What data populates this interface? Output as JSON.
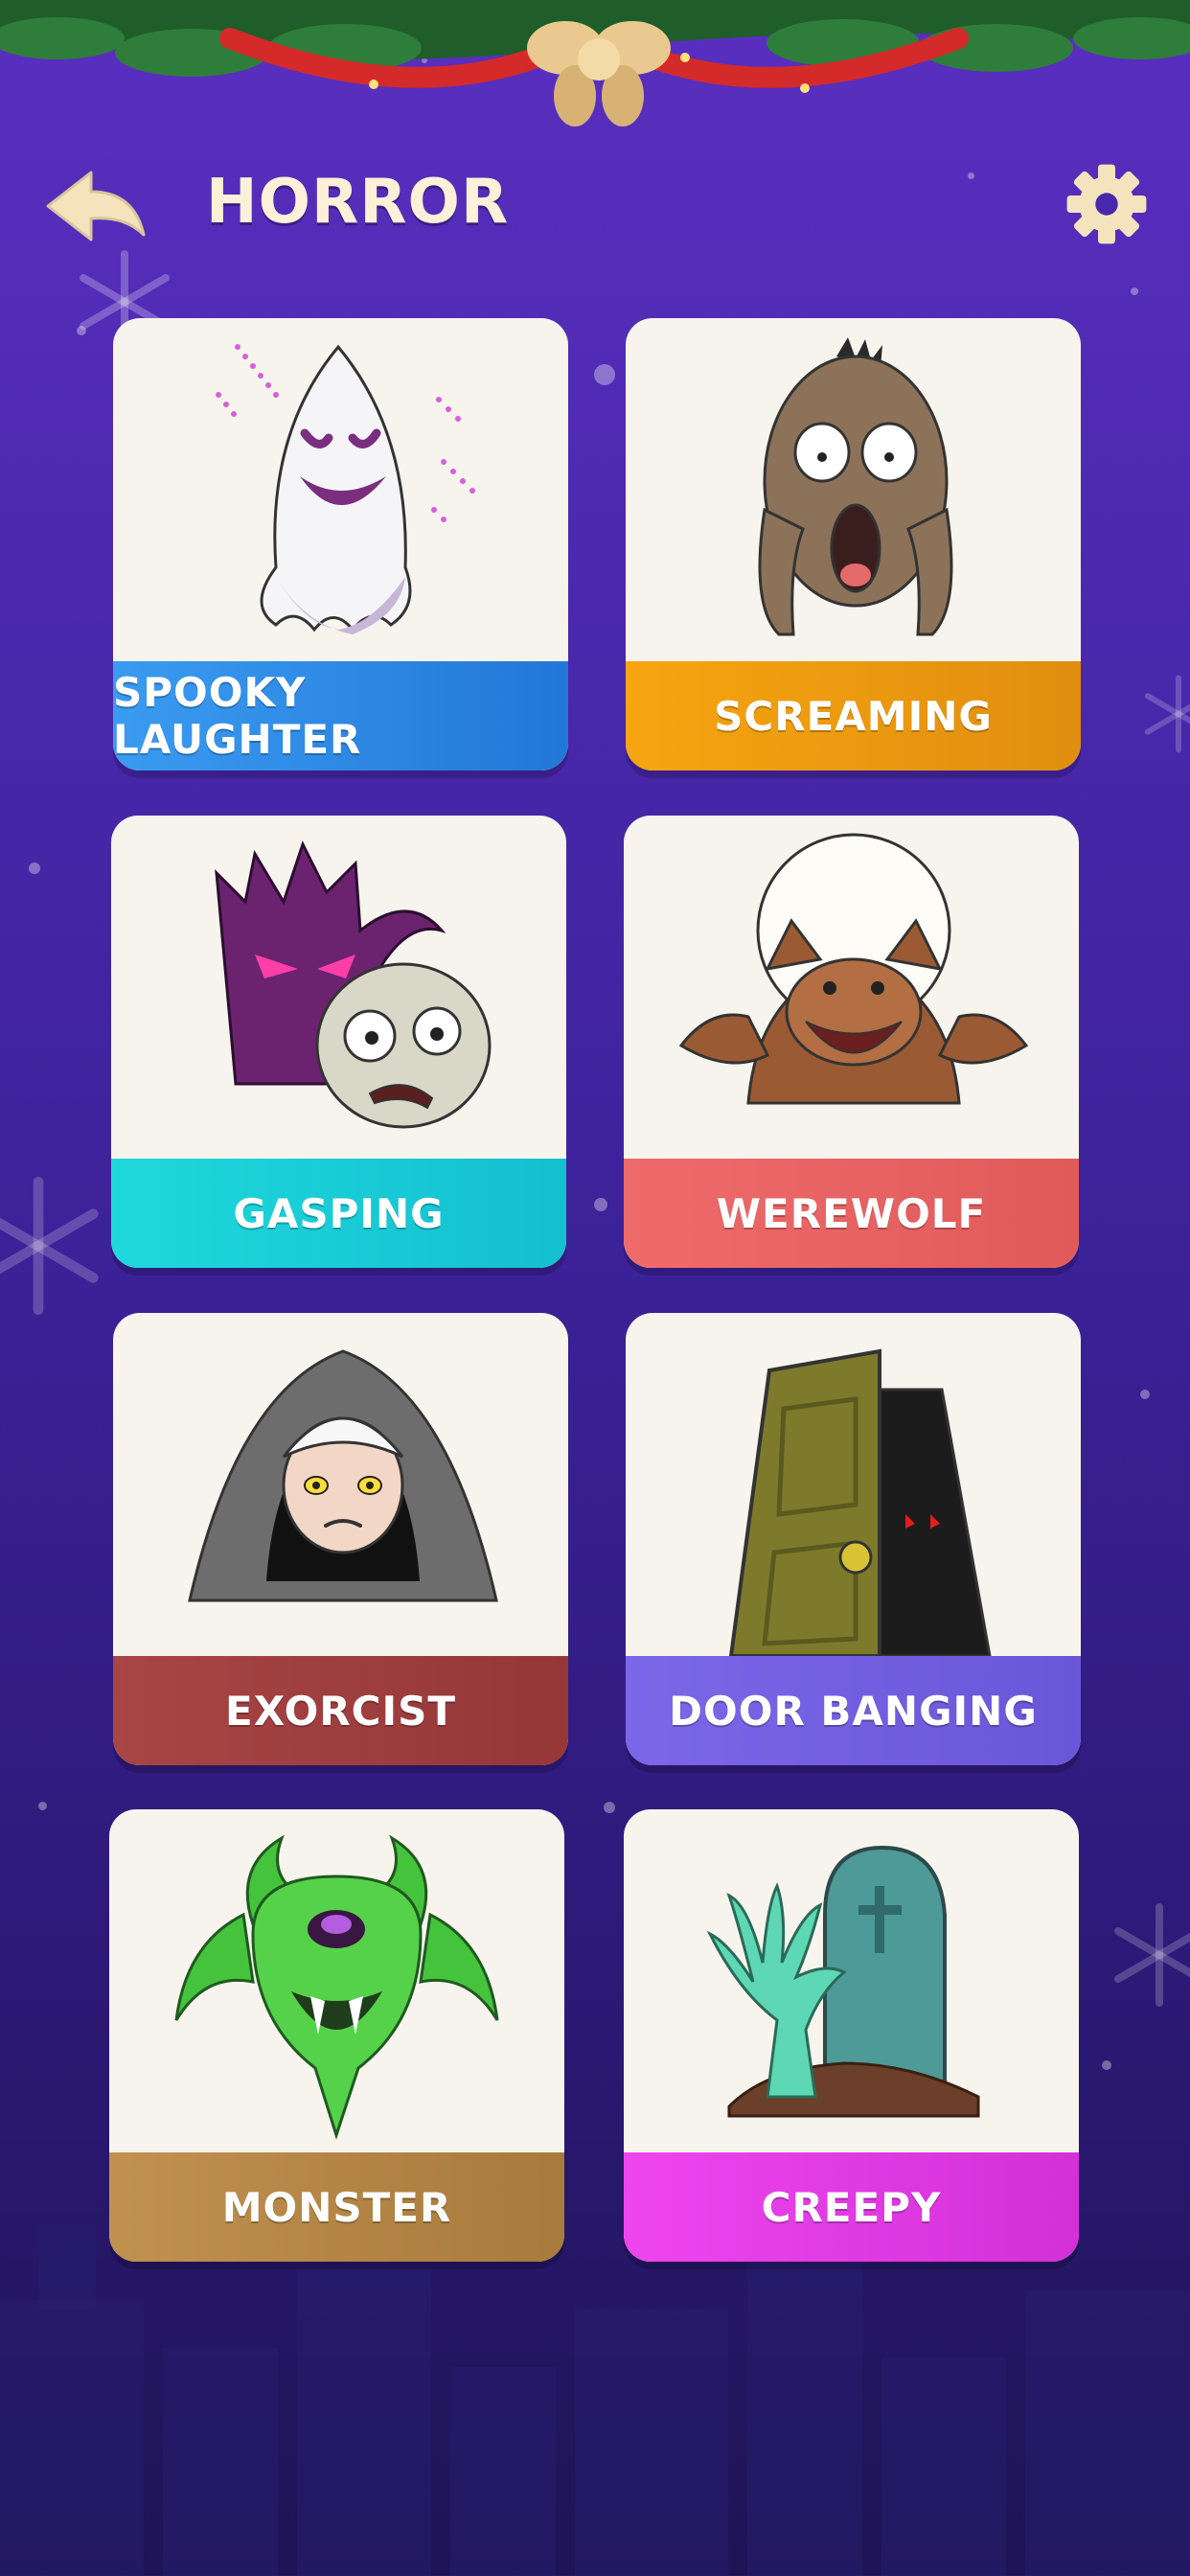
{
  "header": {
    "title": "HORROR"
  },
  "colors": {
    "background_top": "#5a2fc0",
    "background_bottom": "#1e1455",
    "title": "#fbf0d8",
    "icon": "#f4e3bd"
  },
  "icons": {
    "back": "back-arrow-icon",
    "settings": "gear-icon"
  },
  "categories": [
    {
      "label": "SPOOKY LAUGHTER",
      "color": "#2f8be8",
      "icon": "ghost-icon"
    },
    {
      "label": "SCREAMING",
      "color": "#f39a12",
      "icon": "screaming-face-icon"
    },
    {
      "label": "GASPING",
      "color": "#1ecfd6",
      "icon": "gasping-zombie-icon"
    },
    {
      "label": "WEREWOLF",
      "color": "#ea6464",
      "icon": "werewolf-icon"
    },
    {
      "label": "EXORCIST",
      "color": "#9c3c3c",
      "icon": "nun-icon"
    },
    {
      "label": "DOOR BANGING",
      "color": "#7560e0",
      "icon": "door-icon"
    },
    {
      "label": "MONSTER",
      "color": "#b8884a",
      "icon": "monster-icon"
    },
    {
      "label": "CREEPY",
      "color": "#e23ee6",
      "icon": "zombie-hand-grave-icon"
    }
  ]
}
